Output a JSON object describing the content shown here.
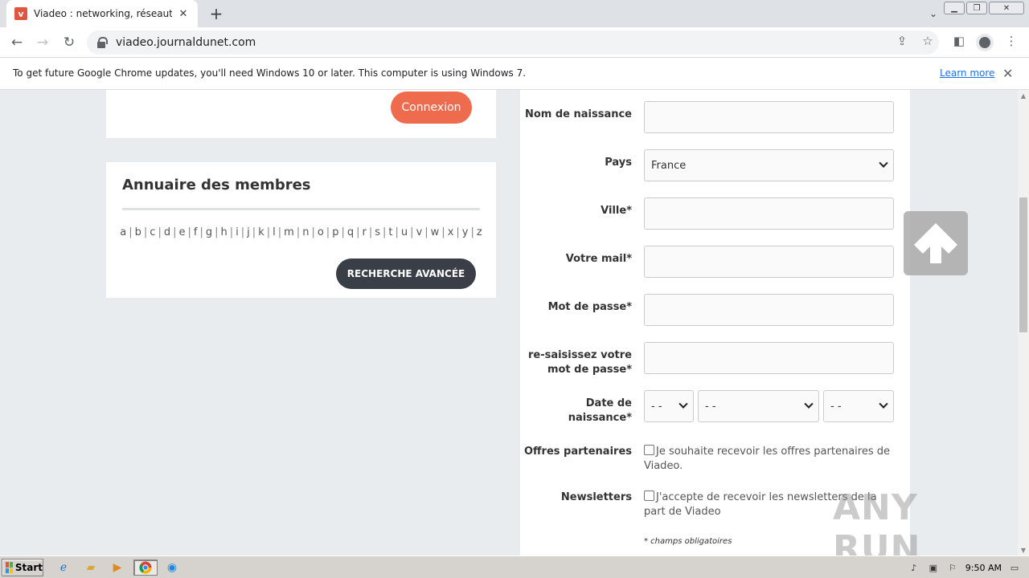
{
  "browser": {
    "tab_title": "Viadeo : networking, réseautage pro",
    "url": "viadeo.journaldunet.com",
    "infobar_text": "To get future Google Chrome updates, you'll need Windows 10 or later. This computer is using Windows 7.",
    "infobar_link": "Learn more"
  },
  "login": {
    "connexion_label": "Connexion"
  },
  "annuaire": {
    "title": "Annuaire des membres",
    "letters": [
      "a",
      "b",
      "c",
      "d",
      "e",
      "f",
      "g",
      "h",
      "i",
      "j",
      "k",
      "l",
      "m",
      "n",
      "o",
      "p",
      "q",
      "r",
      "s",
      "t",
      "u",
      "v",
      "w",
      "x",
      "y",
      "z"
    ],
    "advanced_search_label": "RECHERCHE AVANCÉE"
  },
  "form": {
    "birth_name_label": "Nom de naissance",
    "country_label": "Pays",
    "country_value": "France",
    "city_label": "Ville*",
    "email_label": "Votre mail*",
    "password_label": "Mot de passe*",
    "password_confirm_label": "re-saisissez votre mot de passe*",
    "birthdate_label": "Date de naissance*",
    "birth_day_value": "- -",
    "birth_month_value": "- -",
    "birth_year_value": "- -",
    "partners_label": "Offres partenaires",
    "partners_text": "Je souhaite recevoir les offres partenaires de Viadeo.",
    "partners_checked": false,
    "newsletters_label": "Newsletters",
    "newsletters_text": "J'accepte de recevoir les newsletters de la part de Viadeo",
    "newsletters_checked": false,
    "required_note": "* champs obligatoires"
  },
  "watermark": "ANY RUN",
  "taskbar": {
    "start_label": "Start",
    "clock": "9:50 AM"
  },
  "colors": {
    "accent_orange": "#ee6c4d",
    "dark_button": "#3a3f47",
    "link_blue": "#1a73e8"
  }
}
